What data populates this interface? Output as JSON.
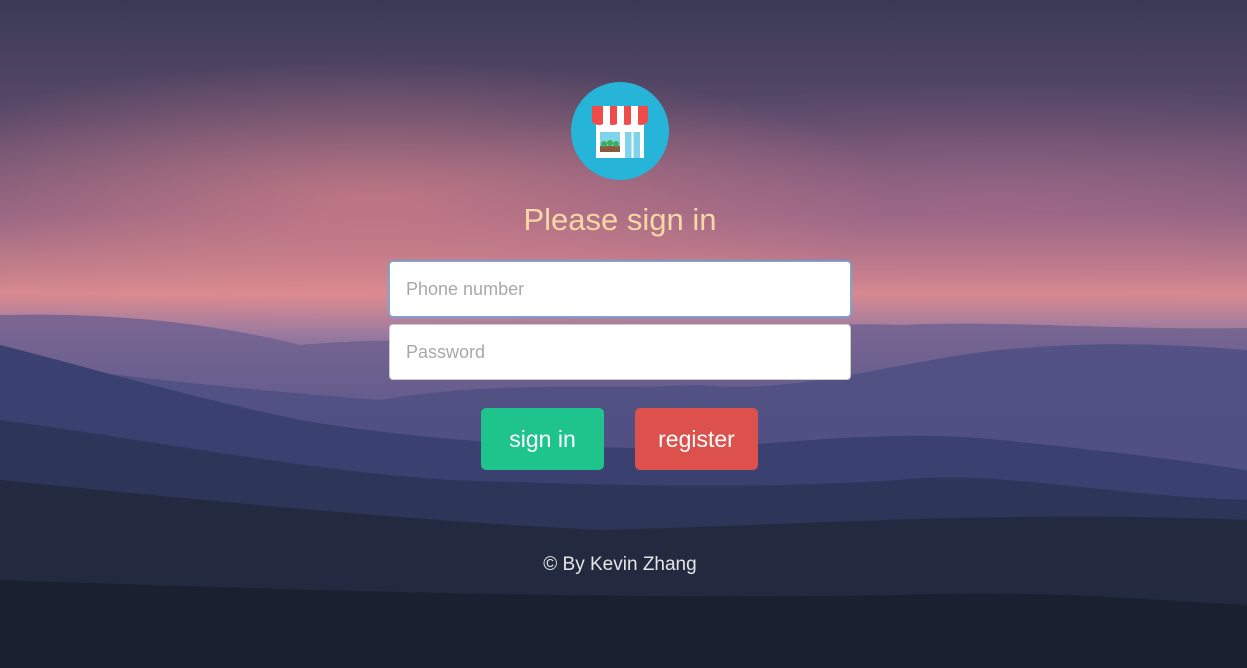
{
  "logo": {
    "icon": "storefront-icon"
  },
  "title": "Please sign in",
  "form": {
    "phone_placeholder": "Phone number",
    "password_placeholder": "Password"
  },
  "buttons": {
    "signin_label": "sign in",
    "register_label": "register"
  },
  "footer": "© By Kevin Zhang",
  "colors": {
    "title": "#f6d7a6",
    "logo_bg": "#26b5d8",
    "signin": "#1fc38c",
    "register": "#dc514c"
  }
}
